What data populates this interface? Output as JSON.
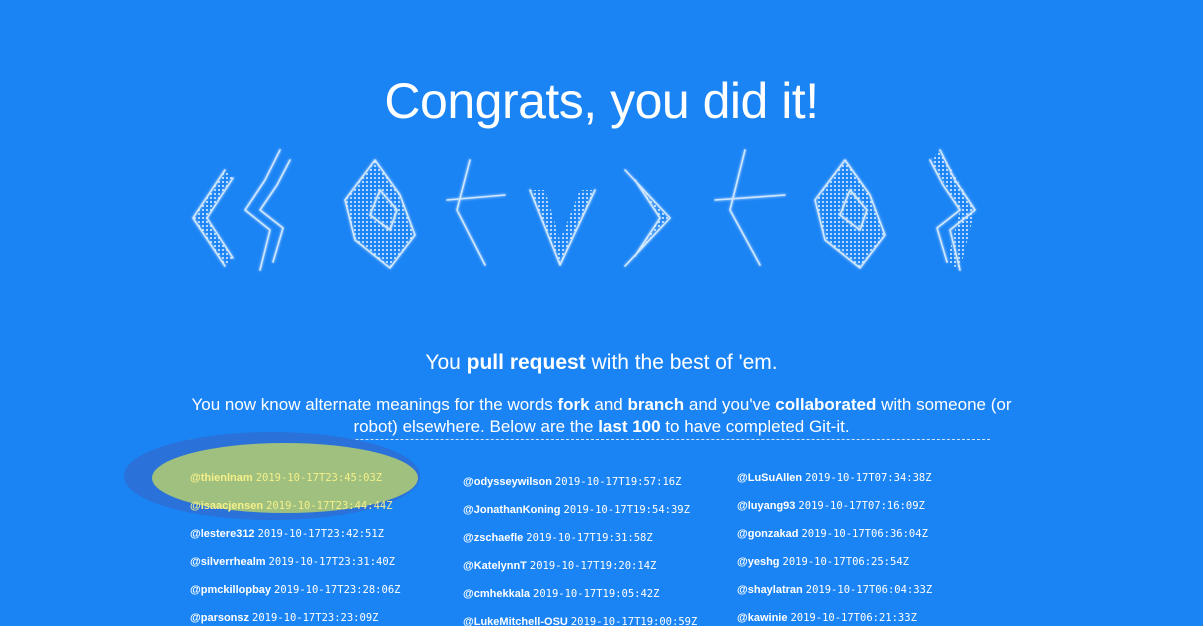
{
  "heading": "Congrats, you did it!",
  "lead": {
    "pre": "You ",
    "bold": "pull request",
    "post": " with the best of 'em."
  },
  "description": {
    "t1": "You now know alternate meanings for the words ",
    "b1": "fork",
    "t2": " and ",
    "b2": "branch",
    "t3": " and you've ",
    "b3": "collaborated",
    "t4": " with someone (or robot) elsewhere. Below are the ",
    "b4": "last 100",
    "t5": " to have completed Git-it."
  },
  "colors": {
    "background": "#1b84f5",
    "highlight": "#9fc07e",
    "highlight_text": "#f6f08a"
  },
  "completers": {
    "col1": [
      {
        "user": "@thienlnam",
        "time": "2019-10-17T23:45:03Z"
      },
      {
        "user": "@isaacjensen",
        "time": "2019-10-17T23:44:44Z"
      },
      {
        "user": "@lestere312",
        "time": "2019-10-17T23:42:51Z"
      },
      {
        "user": "@silverrhealm",
        "time": "2019-10-17T23:31:40Z"
      },
      {
        "user": "@pmckillopbay",
        "time": "2019-10-17T23:28:06Z"
      },
      {
        "user": "@parsonsz",
        "time": "2019-10-17T23:23:09Z"
      }
    ],
    "col2": [
      {
        "user": "@odysseywilson",
        "time": "2019-10-17T19:57:16Z"
      },
      {
        "user": "@JonathanKoning",
        "time": "2019-10-17T19:54:39Z"
      },
      {
        "user": "@zschaefle",
        "time": "2019-10-17T19:31:58Z"
      },
      {
        "user": "@KatelynnT",
        "time": "2019-10-17T19:20:14Z"
      },
      {
        "user": "@cmhekkala",
        "time": "2019-10-17T19:05:42Z"
      },
      {
        "user": "@LukeMitchell-OSU",
        "time": "2019-10-17T19:00:59Z"
      }
    ],
    "col3": [
      {
        "user": "@LuSuAllen",
        "time": "2019-10-17T07:34:38Z"
      },
      {
        "user": "@luyang93",
        "time": "2019-10-17T07:16:09Z"
      },
      {
        "user": "@gonzakad",
        "time": "2019-10-17T06:36:04Z"
      },
      {
        "user": "@yeshg",
        "time": "2019-10-17T06:25:54Z"
      },
      {
        "user": "@shaylatran",
        "time": "2019-10-17T06:04:33Z"
      },
      {
        "user": "@kawinie",
        "time": "2019-10-17T06:21:33Z"
      }
    ]
  },
  "ascii_art_icon": "git-it-ascii-logo"
}
